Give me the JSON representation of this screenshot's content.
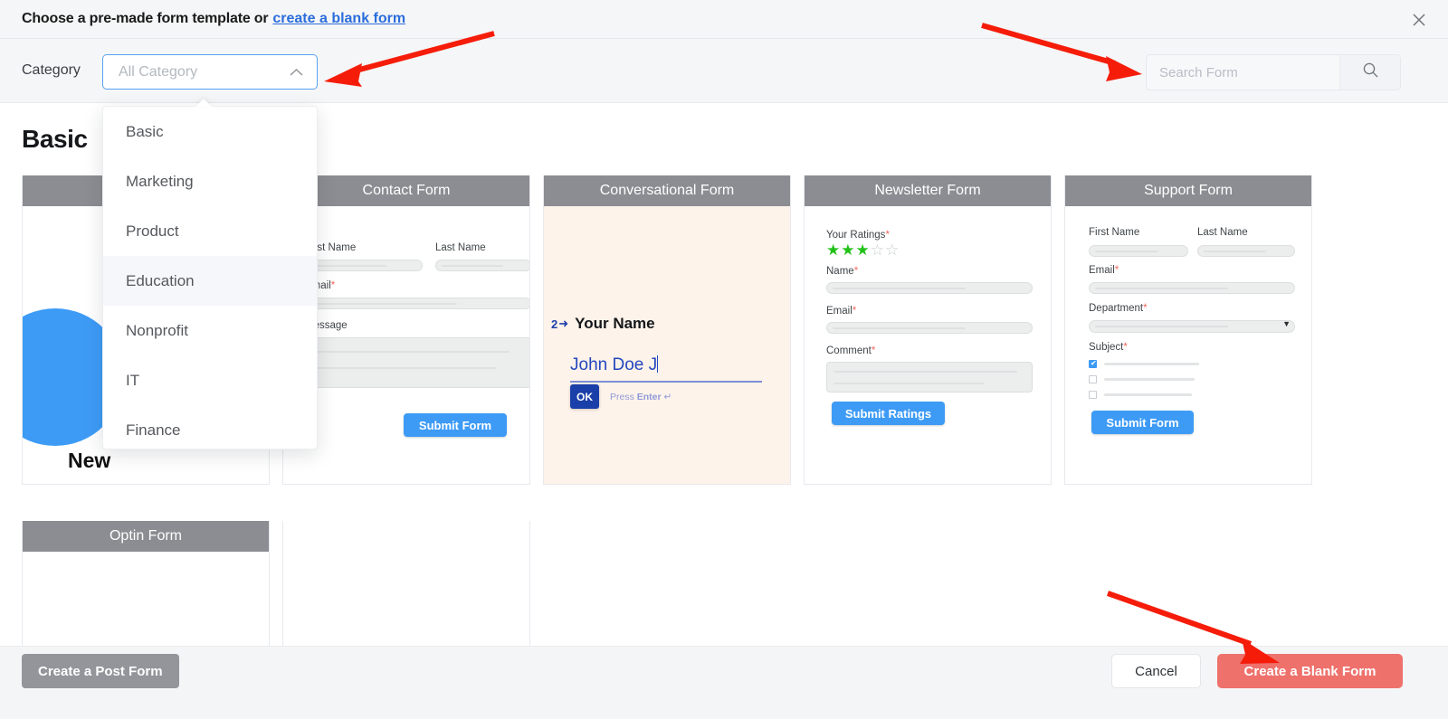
{
  "header": {
    "title": "Choose a pre-made form template or",
    "link_label": "create a blank form",
    "close_icon": "close-icon"
  },
  "toolbar": {
    "category_label": "Category",
    "category_selected": "All Category",
    "category_chevron_icon": "chevron-up-icon",
    "search_placeholder": "Search Form",
    "search_value": "",
    "search_icon": "search-icon"
  },
  "category_dropdown": {
    "open": true,
    "options": [
      {
        "label": "Basic",
        "active": false
      },
      {
        "label": "Marketing",
        "active": false
      },
      {
        "label": "Product",
        "active": false
      },
      {
        "label": "Education",
        "active": true
      },
      {
        "label": "Nonprofit",
        "active": false
      },
      {
        "label": "IT",
        "active": false
      },
      {
        "label": "Finance",
        "active": false
      }
    ]
  },
  "main": {
    "section_title": "Basic",
    "cards": [
      {
        "title": "",
        "kind": "newsletter-circle",
        "caption": "New"
      },
      {
        "title": "Contact Form",
        "kind": "contact",
        "fields": {
          "first_name": "First Name",
          "last_name": "Last Name",
          "email": "Email",
          "message": "Message"
        },
        "submit_label": "Submit Form"
      },
      {
        "title": "Conversational Form",
        "kind": "conversational",
        "step_number": "2",
        "question": "Your Name",
        "answer_value": "John Doe J",
        "ok_label": "OK",
        "hint_prefix": "Press",
        "hint_key": "Enter"
      },
      {
        "title": "Newsletter Form",
        "kind": "newsletter",
        "fields": {
          "ratings": "Your Ratings",
          "name": "Name",
          "email": "Email",
          "comment": "Comment"
        },
        "rating_filled": 3,
        "rating_total": 5,
        "submit_label": "Submit Ratings"
      },
      {
        "title": "Support Form",
        "kind": "support",
        "fields": {
          "first_name": "First Name",
          "last_name": "Last Name",
          "email": "Email",
          "department": "Department",
          "subject": "Subject"
        },
        "checkbox_states": [
          true,
          false,
          false
        ],
        "submit_label": "Submit Form"
      },
      {
        "title": "Optin Form",
        "kind": "optin"
      }
    ]
  },
  "footer": {
    "post_form_label": "Create a Post Form",
    "cancel_label": "Cancel",
    "blank_form_label": "Create a Blank Form"
  },
  "colors": {
    "accent_blue": "#3d9bf6",
    "link_blue": "#2a6ddb",
    "danger_red": "#ee716c",
    "card_header_gray": "#8b8d92",
    "star_green": "#22c118",
    "required_red": "#f4685f",
    "annotation_red": "#f51d0a",
    "conversational_bg": "#fdf3ea"
  },
  "annotations": [
    {
      "name": "arrow-to-category-select"
    },
    {
      "name": "arrow-to-search-form"
    },
    {
      "name": "arrow-to-create-blank-form"
    }
  ]
}
